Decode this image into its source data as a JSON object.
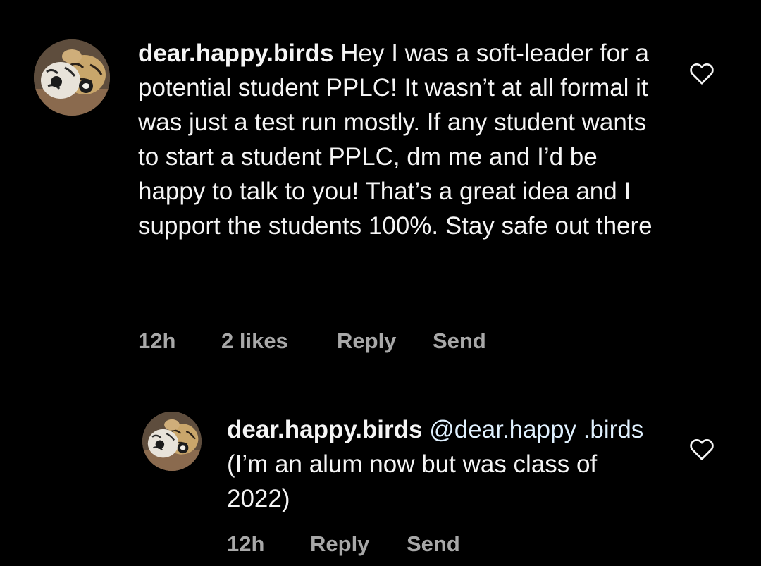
{
  "comment": {
    "avatar": "tiger-plush-toys-avatar",
    "username": "dear.happy.birds",
    "text": "Hey I was a soft-leader for a potential student PPLC! It wasn’t at all formal it was just a test run mostly. If any student wants to start a student PPLC, dm me and I’d be happy to talk to you! That’s a great idea and I support the students 100%. Stay safe out there",
    "time": "12h",
    "likes": "2 likes",
    "reply_label": "Reply",
    "send_label": "Send",
    "like_icon": "heart-outline-icon"
  },
  "reply": {
    "avatar": "tiger-plush-toys-avatar",
    "username": "dear.happy.birds",
    "mention": "@dear.happy .birds",
    "text": "(I’m an alum now but was class of 2022)",
    "time": "12h",
    "reply_label": "Reply",
    "send_label": "Send",
    "like_icon": "heart-outline-icon"
  },
  "colors": {
    "background": "#000000",
    "text": "#f5f5f5",
    "secondary_text": "#a8a8a8",
    "mention": "#e0f1ff"
  }
}
